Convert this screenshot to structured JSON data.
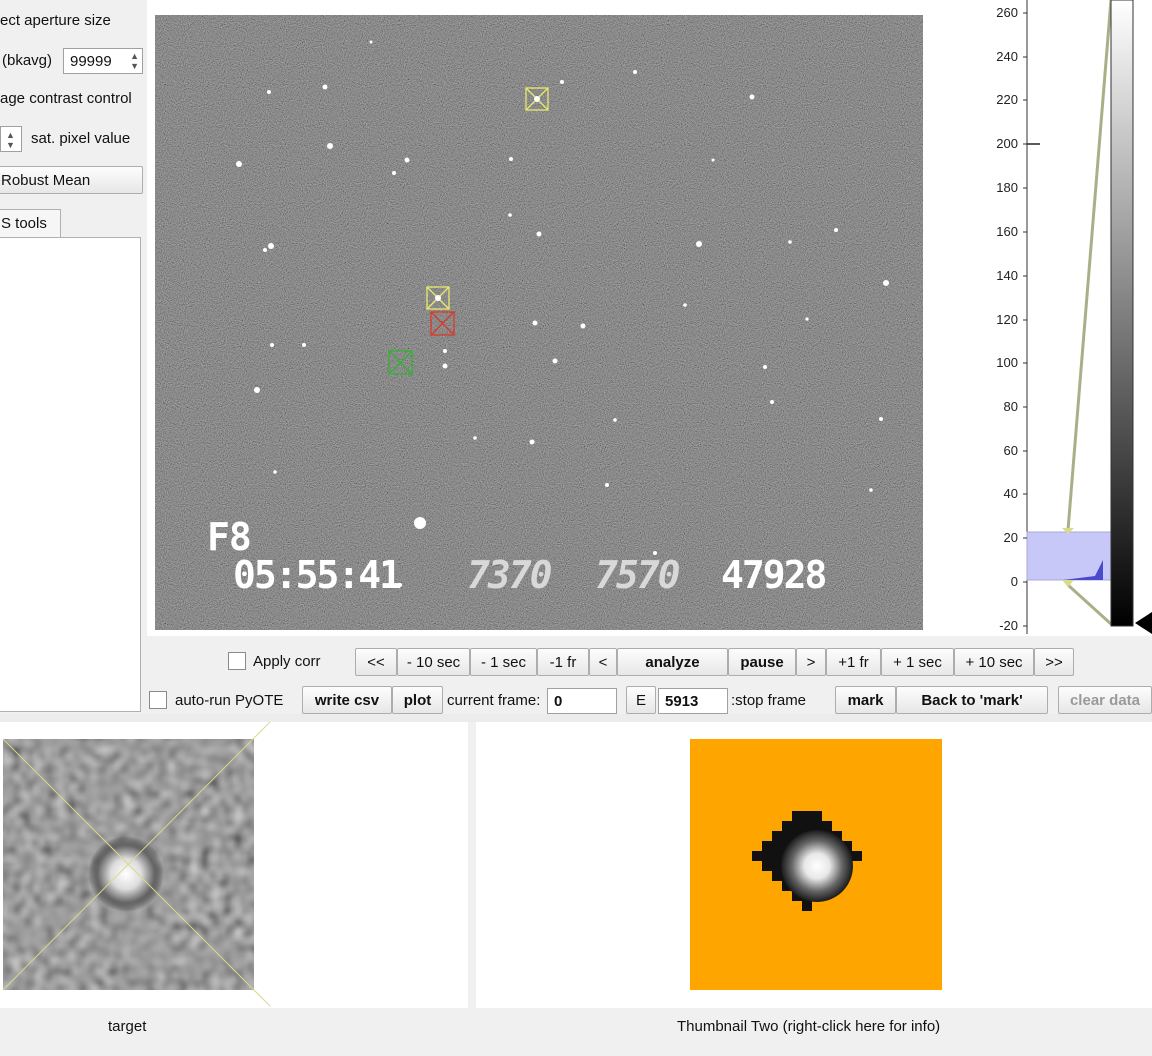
{
  "left_panel": {
    "aperture_label": "ect aperture size",
    "bkavg_label": "(bkavg)",
    "bkavg_value": "99999",
    "contrast_label": "age contrast control",
    "sat_label": "sat. pixel value",
    "robust_mean_button": "Robust Mean",
    "tools_tab": "S tools"
  },
  "image_overlay": {
    "frame_label": "F8",
    "timestamp": "05:55:41",
    "code1": "7370",
    "code2": "7570",
    "code3": "47928"
  },
  "histogram": {
    "y_ticks": [
      "260",
      "240",
      "220",
      "200",
      "180",
      "160",
      "140",
      "120",
      "100",
      "80",
      "60",
      "40",
      "20",
      "0",
      "-20"
    ]
  },
  "controls": {
    "apply_corr": "Apply corr",
    "nav_buttons": [
      "<<",
      "- 10 sec",
      "- 1 sec",
      "-1 fr",
      "<",
      "analyze",
      "pause",
      ">",
      "+1 fr",
      "+ 1 sec",
      "+ 10 sec",
      ">>"
    ],
    "auto_run": "auto-run PyOTE",
    "write_csv": "write csv",
    "plot": "plot",
    "current_frame_label": "current frame:",
    "current_frame_value": "0",
    "e_button": "E",
    "stop_frame_value": "5913",
    "stop_frame_label": ":stop frame",
    "mark": "mark",
    "back_to_mark": "Back to 'mark'",
    "clear_data": "clear data"
  },
  "thumbnails": {
    "target_label": "target",
    "thumb_two_label": "Thumbnail Two (right-click here for info)",
    "thumb_two_bg": "#ffa500"
  },
  "colors": {
    "aperture_yellow": "#e8e86a",
    "aperture_red": "#d83a2a",
    "aperture_green": "#34b034",
    "histogram_fill": "#c8c8f8"
  }
}
